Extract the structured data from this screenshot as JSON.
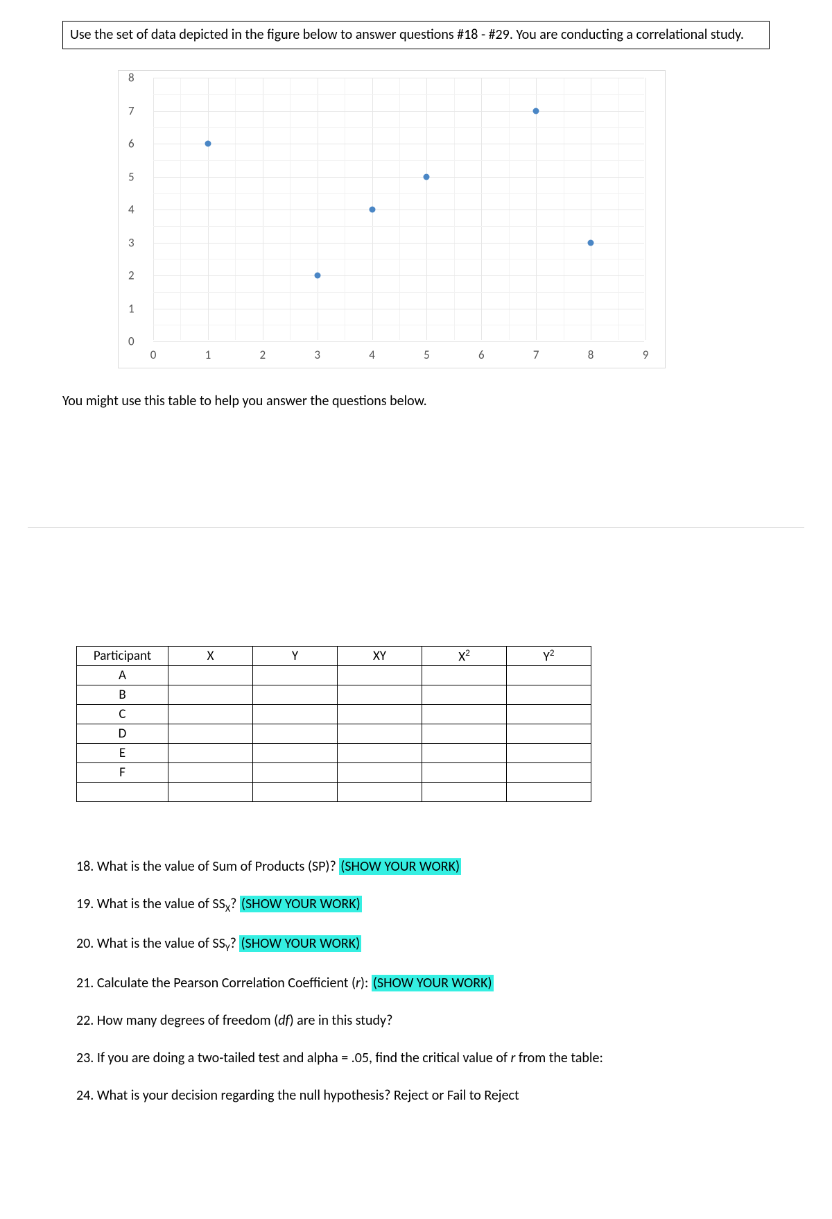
{
  "instruction": "Use the set of data depicted in the figure below to answer questions #18 - #29. You are conducting a correlational study.",
  "chart_data": {
    "type": "scatter",
    "x": [
      1,
      3,
      4,
      5,
      7,
      8
    ],
    "y": [
      6,
      2,
      4,
      5,
      7,
      3
    ],
    "xlim": [
      0,
      9
    ],
    "ylim": [
      0,
      8
    ],
    "x_ticks": [
      0,
      1,
      2,
      3,
      4,
      5,
      6,
      7,
      8,
      9
    ],
    "y_ticks": [
      0,
      1,
      2,
      3,
      4,
      5,
      6,
      7,
      8
    ],
    "title": "",
    "xlabel": "",
    "ylabel": ""
  },
  "helper_text": "You might use this table to help you answer the questions below.",
  "table": {
    "headers": [
      "Participant",
      "X",
      "Y",
      "XY",
      "X²",
      "Y²"
    ],
    "rows": [
      "A",
      "B",
      "C",
      "D",
      "E",
      "F",
      ""
    ]
  },
  "questions": {
    "q18_pre": "18. What is the value of Sum of Products (SP)? ",
    "q18_hl": "(SHOW YOUR WORK)",
    "q19_pre": "19. What is the value of SS",
    "q19_sub": "X",
    "q19_post": "? ",
    "q19_hl": "(SHOW YOUR WORK)",
    "q20_pre": "20. What is the value of SS",
    "q20_sub": "Y",
    "q20_post": "? ",
    "q20_hl": "(SHOW YOUR WORK)",
    "q21_pre": "21. Calculate the Pearson Correlation Coefficient (",
    "q21_it": "r",
    "q21_post": "): ",
    "q21_hl": "(SHOW YOUR WORK)",
    "q22_pre": "22. How many degrees of freedom (",
    "q22_it": "df",
    "q22_post": ") are in this study?",
    "q23_pre": "23. If you are doing a two-tailed test and alpha = .05, find the critical value of ",
    "q23_it": "r",
    "q23_post": " from the table:",
    "q24": "24. What is your decision regarding the null hypothesis? Reject or Fail to Reject"
  }
}
